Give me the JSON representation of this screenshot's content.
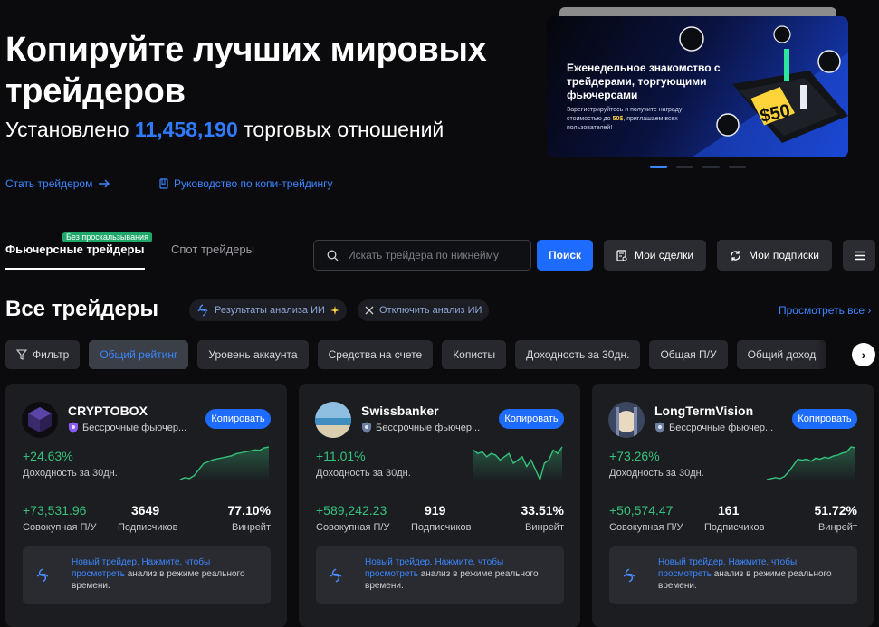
{
  "hero": {
    "title": "Копируйте лучших мировых трейдеров",
    "subtitle_prefix": "Установлено",
    "subtitle_count": "11,458,190",
    "subtitle_suffix": "торговых отношений",
    "link_become": "Стать трейдером",
    "link_guide": "Руководство по копи-трейдингу"
  },
  "banner": {
    "title": "Еженедельное знакомство с трейдерами, торгующими фьючерсами",
    "text_before": "Зарегистрируйтесь и получите награду стоимостью до",
    "text_amount": "50$",
    "text_after": ", приглашаем всех пользователей!",
    "badge": "$50",
    "active_slide": 0,
    "slide_count": 4
  },
  "tabs": {
    "futures": "Фьючерсные трейдеры",
    "futures_badge": "Без проскальзывания",
    "spot": "Спот трейдеры"
  },
  "search": {
    "placeholder": "Искать трейдера по никнейму",
    "button": "Поиск"
  },
  "actions": {
    "my_trades": "Мои сделки",
    "my_subscriptions": "Мои подписки"
  },
  "section": {
    "title": "Все трейдеры",
    "ai_results": "Результаты анализа ИИ",
    "ai_disable": "Отключить анализ ИИ",
    "view_all": "Просмотреть все"
  },
  "filters": [
    "Фильтр",
    "Общий рейтинг",
    "Уровень аккаунта",
    "Средства на счете",
    "Кописты",
    "Доходность за 30дн.",
    "Общая П/У",
    "Общий доход"
  ],
  "active_filter": 1,
  "card_labels": {
    "copy": "Копировать",
    "roi_label": "Доходность за 30дн.",
    "pnl_label": "Совокупная П/У",
    "subs_label": "Подписчиков",
    "winrate_label": "Винрейт",
    "note_before": "Новый трейдер. Нажмите, чтобы",
    "note_link": "просмотреть",
    "note_after": "анализ в режиме реального времени."
  },
  "traders": [
    {
      "name": "CRYPTOBOX",
      "type": "Бессрочные фьючер...",
      "roi": "+24.63%",
      "pnl": "+73,531.96",
      "subscribers": "3649",
      "winrate": "77.10%",
      "badge_color": "#8b5cf6",
      "avatar": "cube-avatar",
      "roi_trend": [
        2,
        3,
        2.5,
        4,
        7,
        10,
        11,
        12,
        12.5,
        13,
        13.5,
        14,
        15,
        15.5,
        16,
        16.5,
        17,
        16.8,
        18,
        18.5
      ]
    },
    {
      "name": "Swissbanker",
      "type": "Бессрочные фьючер...",
      "roi": "+11.01%",
      "pnl": "+589,242.23",
      "subscribers": "919",
      "winrate": "33.51%",
      "badge_color": "#6b7fa3",
      "avatar": "beach-avatar",
      "roi_trend": [
        12,
        11,
        11.5,
        10,
        11,
        10.5,
        9,
        10,
        11,
        8,
        9,
        10,
        7,
        9,
        6,
        3,
        8,
        9,
        12,
        11,
        13
      ]
    },
    {
      "name": "LongTermVision",
      "type": "Бессрочные фьючер...",
      "roi": "+73.26%",
      "pnl": "+50,574.47",
      "subscribers": "161",
      "winrate": "51.72%",
      "badge_color": "#6b7fa3",
      "avatar": "light-avatar",
      "roi_trend": [
        2,
        2.5,
        3,
        2.5,
        3.5,
        6,
        9,
        12,
        11.5,
        12,
        11,
        12.5,
        12,
        13,
        12.5,
        13.5,
        14,
        15,
        15.5,
        18,
        17.5
      ]
    }
  ]
}
